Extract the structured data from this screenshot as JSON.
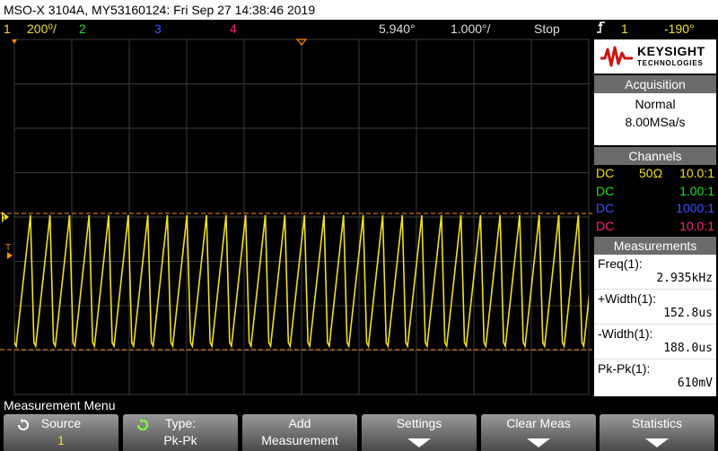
{
  "title_bar": "MSO-X 3104A, MY53160124: Fri Sep 27 14:38:46 2019",
  "status": {
    "ch1_num": "1",
    "ch1_scale": "200⁰/",
    "ch2_num": "2",
    "ch3_num": "3",
    "ch4_num": "4",
    "time_pos": "5.940°",
    "time_scale": "1.000°/",
    "run_state": "Stop",
    "trig_icon": "rising-edge-icon",
    "trig_source": "1",
    "trig_level": "-190°"
  },
  "brand": {
    "name": "KEYSIGHT",
    "sub": "TECHNOLOGIES"
  },
  "acquisition": {
    "header": "Acquisition",
    "mode": "Normal",
    "rate": "8.00MSa/s"
  },
  "channels": {
    "header": "Channels",
    "rows": [
      {
        "coupling": "DC",
        "impedance": "50Ω",
        "probe": "10.0:1",
        "color": "#f0e020"
      },
      {
        "coupling": "DC",
        "impedance": "",
        "probe": "1.00:1",
        "color": "#20e020"
      },
      {
        "coupling": "DC",
        "impedance": "",
        "probe": "1000:1",
        "color": "#4050ff"
      },
      {
        "coupling": "DC",
        "impedance": "",
        "probe": "10.0:1",
        "color": "#ff2080"
      }
    ]
  },
  "measurements": {
    "header": "Measurements",
    "rows": [
      {
        "label": "Freq(1):",
        "value": "2.935kHz"
      },
      {
        "label": "+Width(1):",
        "value": "152.8us"
      },
      {
        "label": "-Width(1):",
        "value": "188.0us"
      },
      {
        "label": "Pk-Pk(1):",
        "value": "610mV"
      }
    ]
  },
  "menu": {
    "title": "Measurement Menu",
    "softkeys": [
      {
        "line1": "Source",
        "line2": "1"
      },
      {
        "line1": "Type:",
        "line2": "Pk-Pk"
      },
      {
        "line1": "Add",
        "line2": "Measurement"
      },
      {
        "line1": "Settings",
        "line2": ""
      },
      {
        "line1": "Clear Meas",
        "line2": ""
      },
      {
        "line1": "Statistics",
        "line2": ""
      }
    ]
  },
  "colors": {
    "ch1": "#f0e020",
    "ch2": "#20e020",
    "ch3": "#4050ff",
    "ch4": "#ff2080",
    "cursor": "#ff8c00",
    "grid": "#3a3a3a"
  },
  "waveform": {
    "channel": "1",
    "shape": "sawtooth",
    "cycles_visible": 29.35
  }
}
